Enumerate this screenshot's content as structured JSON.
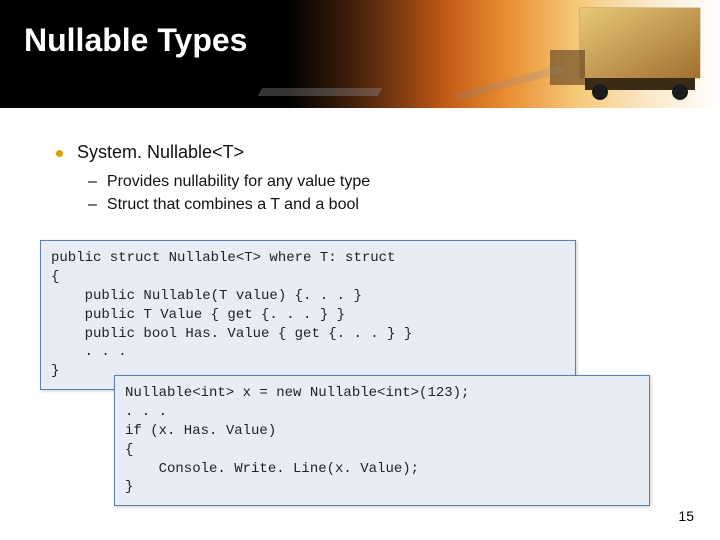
{
  "header": {
    "title": "Nullable Types"
  },
  "content": {
    "bullet1": "System. Nullable<T>",
    "sub1": "Provides nullability for any value type",
    "sub2": "Struct that combines a T and a bool"
  },
  "code1_lines": {
    "l1": "public struct Nullable<T> where T: struct",
    "l2": "{",
    "l3": "    public Nullable(T value) {. . . }",
    "l4": "    public T Value { get {. . . } }",
    "l5": "    public bool Has. Value { get {. . . } }",
    "l6": "    . . .",
    "l7": "}"
  },
  "code2_lines": {
    "l1": "Nullable<int> x = new Nullable<int>(123);",
    "l2": ". . .",
    "l3": "if (x. Has. Value)",
    "l4": "{",
    "l5": "    Console. Write. Line(x. Value);",
    "l6": "}"
  },
  "page_number": "15"
}
